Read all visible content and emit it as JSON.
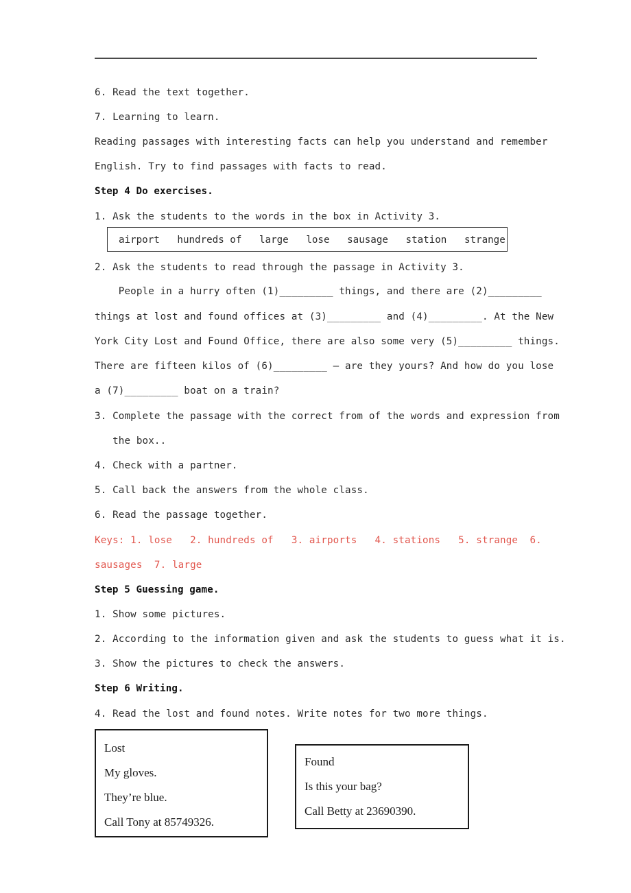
{
  "document": {
    "text_color": "#2b2b2b",
    "keys_color": "#e2564d",
    "rule_color": "#4a4a4a"
  },
  "lines": {
    "item6_read_text": "6. Read the text together.",
    "item7_learning": "7. Learning to learn.",
    "learning_para_1": "Reading passages with interesting facts can help you understand and remember",
    "learning_para_2": "English. Try to find passages with facts to read.",
    "step4_heading": "Step 4 Do exercises.",
    "step4_item1": "1. Ask the students to the words in the box in Activity 3.",
    "step4_item2": "2. Ask the students to read through the passage in Activity 3.",
    "passage_line1": "    People in a hurry often (1)_________ things, and there are (2)_________",
    "passage_line2": "things at lost and found offices at (3)_________ and (4)_________. At the New",
    "passage_line3": "York City Lost and Found Office, there are also some very (5)_________ things.",
    "passage_line4": "There are fifteen kilos of (6)_________ — are they yours? And how do you lose",
    "passage_line5": "a (7)_________ boat on a train?",
    "step4_item3_line1": "3. Complete the passage with the correct from of the words and expression from",
    "step4_item3_line2": "   the box..",
    "step4_item4": "4. Check with a partner.",
    "step4_item5": "5. Call back the answers from the whole class.",
    "step4_item6": "6. Read the passage together.",
    "keys_line1": "Keys: 1. lose   2. hundreds of   3. airports   4. stations   5. strange  6.",
    "keys_line2": "sausages  7. large",
    "step5_heading": "Step 5 Guessing game.",
    "step5_item1": "1. Show some pictures.",
    "step5_item2": "2. According to the information given and ask the students to guess what it is.",
    "step5_item3": "3. Show the pictures to check the answers.",
    "step6_heading": "Step 6 Writing.",
    "step6_item4": "4. Read the lost and found notes. Write notes for two more things."
  },
  "word_box": {
    "words_text": "airport   hundreds of   large   lose   sausage   station   strange",
    "words": [
      "airport",
      "hundreds of",
      "large",
      "lose",
      "sausage",
      "station",
      "strange"
    ]
  },
  "answer_keys": [
    {
      "number": "1.",
      "answer": "lose"
    },
    {
      "number": "2.",
      "answer": "hundreds of"
    },
    {
      "number": "3.",
      "answer": "airports"
    },
    {
      "number": "4.",
      "answer": "stations"
    },
    {
      "number": "5.",
      "answer": "strange"
    },
    {
      "number": "6.",
      "answer": "sausages"
    },
    {
      "number": "7.",
      "answer": "large"
    }
  ],
  "note_lost": {
    "title": "Lost",
    "line2": "My gloves.",
    "line3": "They’re blue.",
    "line4": "Call Tony at 85749326."
  },
  "note_found": {
    "title": "Found",
    "line2": "Is this your bag?",
    "line3": "Call Betty at 23690390."
  }
}
